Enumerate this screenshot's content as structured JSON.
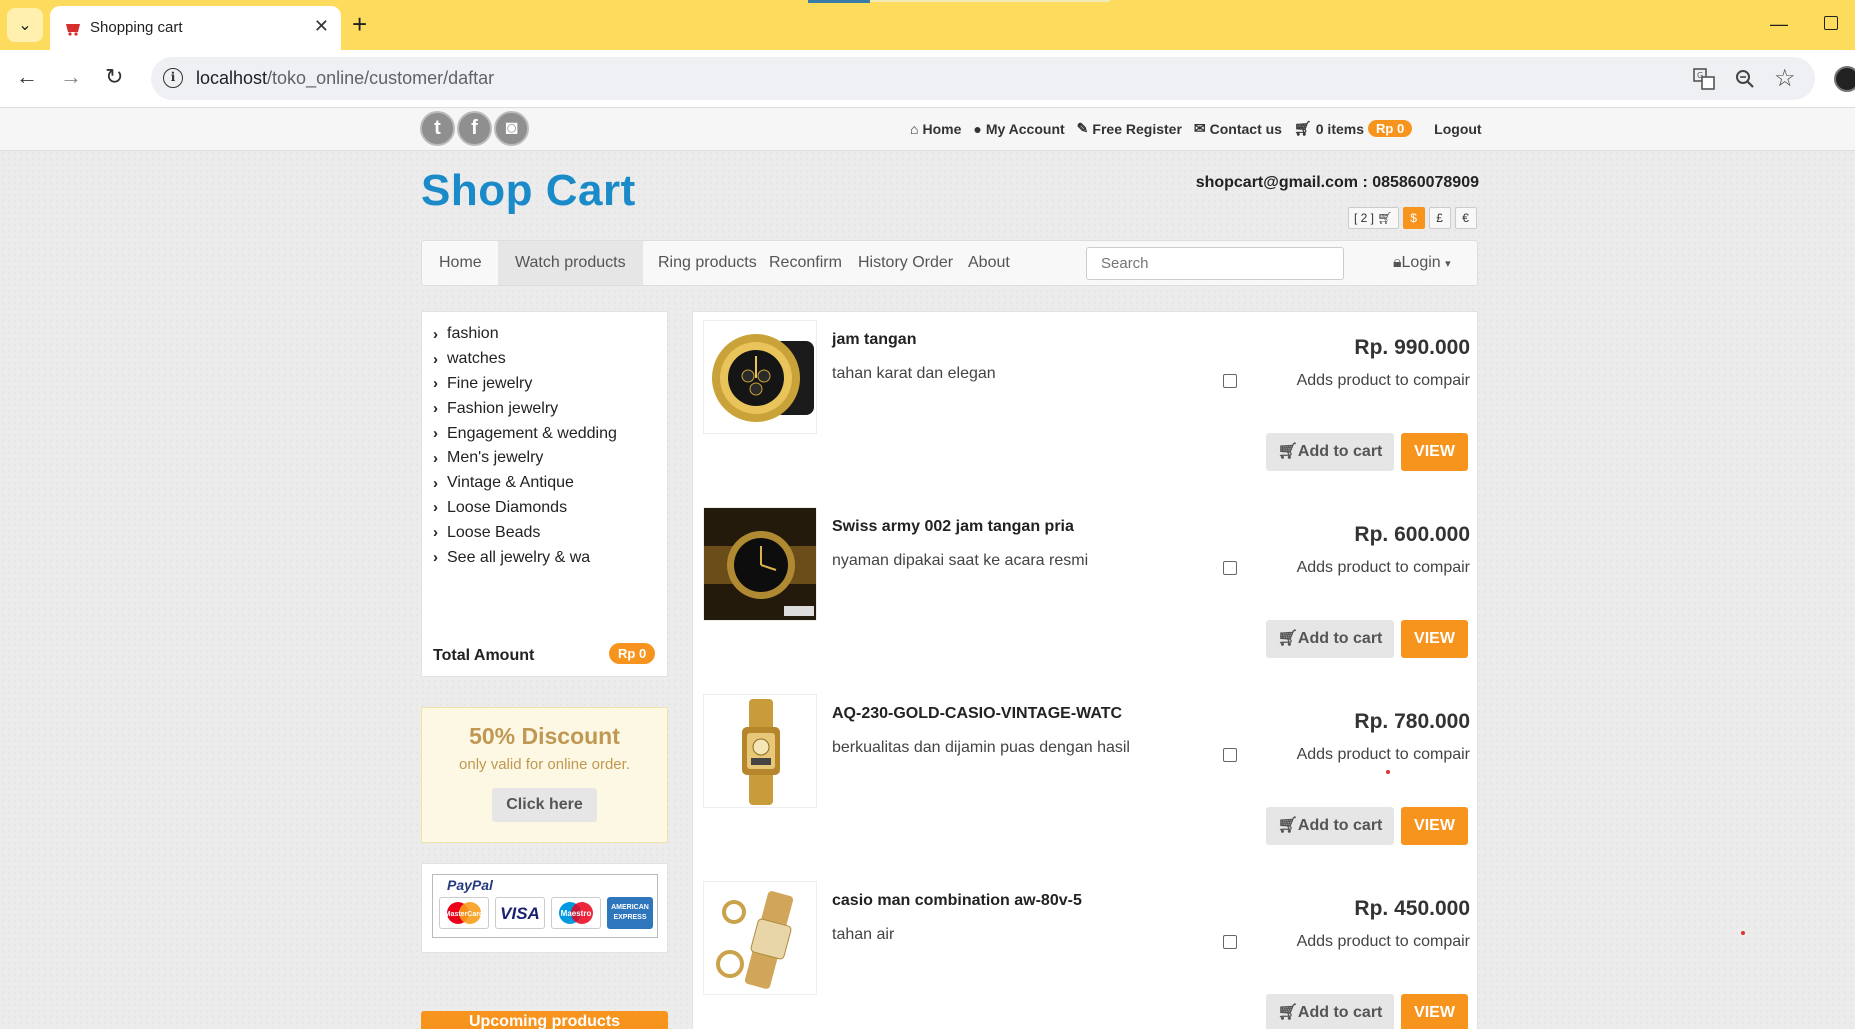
{
  "browser": {
    "tab_title": "Shopping cart",
    "url_host": "localhost",
    "url_path": "/toko_online/customer/daftar"
  },
  "topbar": {
    "links": [
      {
        "icon": "home-icon",
        "label": "Home"
      },
      {
        "icon": "user-icon",
        "label": "My Account"
      },
      {
        "icon": "edit-icon",
        "label": "Free Register"
      },
      {
        "icon": "envelope-icon",
        "label": "Contact us"
      },
      {
        "icon": "cart-icon",
        "label": "0 items"
      }
    ],
    "cart_amount": "Rp 0",
    "logout": "Logout"
  },
  "header": {
    "brand": "Shop Cart",
    "contact": "shopcart@gmail.com : 085860078909",
    "cart_count": "[ 2 ]",
    "currencies": [
      "$",
      "£",
      "€"
    ]
  },
  "nav": {
    "items": [
      "Home",
      "Watch products",
      "Ring products",
      "Reconfirm",
      "History Order",
      "About"
    ],
    "active": "Watch products",
    "search_placeholder": "Search",
    "login": "Login"
  },
  "sidebar": {
    "categories": [
      "fashion",
      "watches",
      "Fine jewelry",
      "Fashion jewelry",
      "Engagement & wedding",
      "Men's jewelry",
      "Vintage & Antique",
      "Loose Diamonds",
      "Loose Beads",
      "See all jewelry & wa"
    ],
    "total_label": "Total Amount",
    "total_value": "Rp 0",
    "discount_title": "50% Discount",
    "discount_sub": "only valid for online order.",
    "discount_button": "Click here",
    "paypal_logo": "PayPal",
    "cards": [
      "MasterCard",
      "VISA",
      "Maestro",
      "AMERICAN EXPRESS"
    ],
    "upcoming": "Upcoming products"
  },
  "products": [
    {
      "name": "jam tangan",
      "desc": "tahan karat dan elegan",
      "price": "Rp. 990.000",
      "compare": "Adds product to compair",
      "cart": "Add to cart",
      "view": "VIEW"
    },
    {
      "name": "Swiss army 002 jam tangan pria",
      "desc": "nyaman dipakai saat ke acara resmi",
      "price": "Rp. 600.000",
      "compare": "Adds product to compair",
      "cart": "Add to cart",
      "view": "VIEW"
    },
    {
      "name": "AQ-230-GOLD-CASIO-VINTAGE-WATC",
      "desc": "berkualitas dan dijamin puas dengan hasil",
      "price": "Rp. 780.000",
      "compare": "Adds product to compair",
      "cart": "Add to cart",
      "view": "VIEW"
    },
    {
      "name": "casio man combination aw-80v-5",
      "desc": "tahan air",
      "price": "Rp. 450.000",
      "compare": "Adds product to compair",
      "cart": "Add to cart",
      "view": "VIEW"
    }
  ],
  "colors": {
    "accent": "#f7941d",
    "brand": "#1a8ac9",
    "chrome": "#fddb5c"
  }
}
